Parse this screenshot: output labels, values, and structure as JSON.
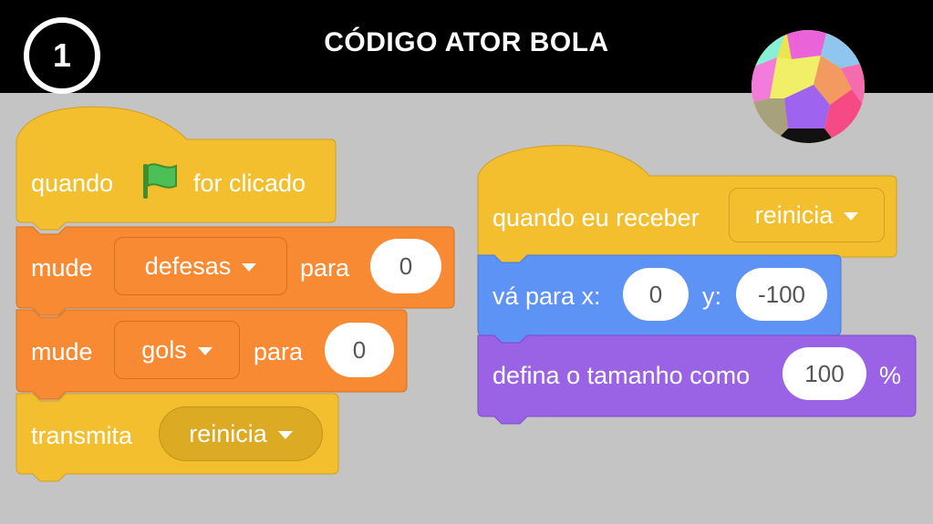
{
  "header": {
    "step_number": "1",
    "title": "CÓDIGO ATOR BOLA"
  },
  "colors": {
    "events": "#f4bf2f",
    "variables": "#f88a34",
    "motion": "#5e93f6",
    "looks": "#9a63e6",
    "background": "#c4c4c4",
    "header": "#000000"
  },
  "script_left": {
    "hat": {
      "label": "quando",
      "label2": "for clicado",
      "icon": "green-flag-icon"
    },
    "block1": {
      "label": "mude",
      "variable": "defesas",
      "label2": "para",
      "value": "0"
    },
    "block2": {
      "label": "mude",
      "variable": "gols",
      "label2": "para",
      "value": "0"
    },
    "block3": {
      "label": "transmita",
      "message": "reinicia"
    }
  },
  "script_right": {
    "hat": {
      "label": "quando eu receber",
      "message": "reinicia"
    },
    "block1": {
      "label": "vá para x:",
      "x_value": "0",
      "y_label": "y:",
      "y_value": "-100"
    },
    "block2": {
      "label": "defina o tamanho como",
      "value": "100",
      "unit": "%"
    }
  }
}
